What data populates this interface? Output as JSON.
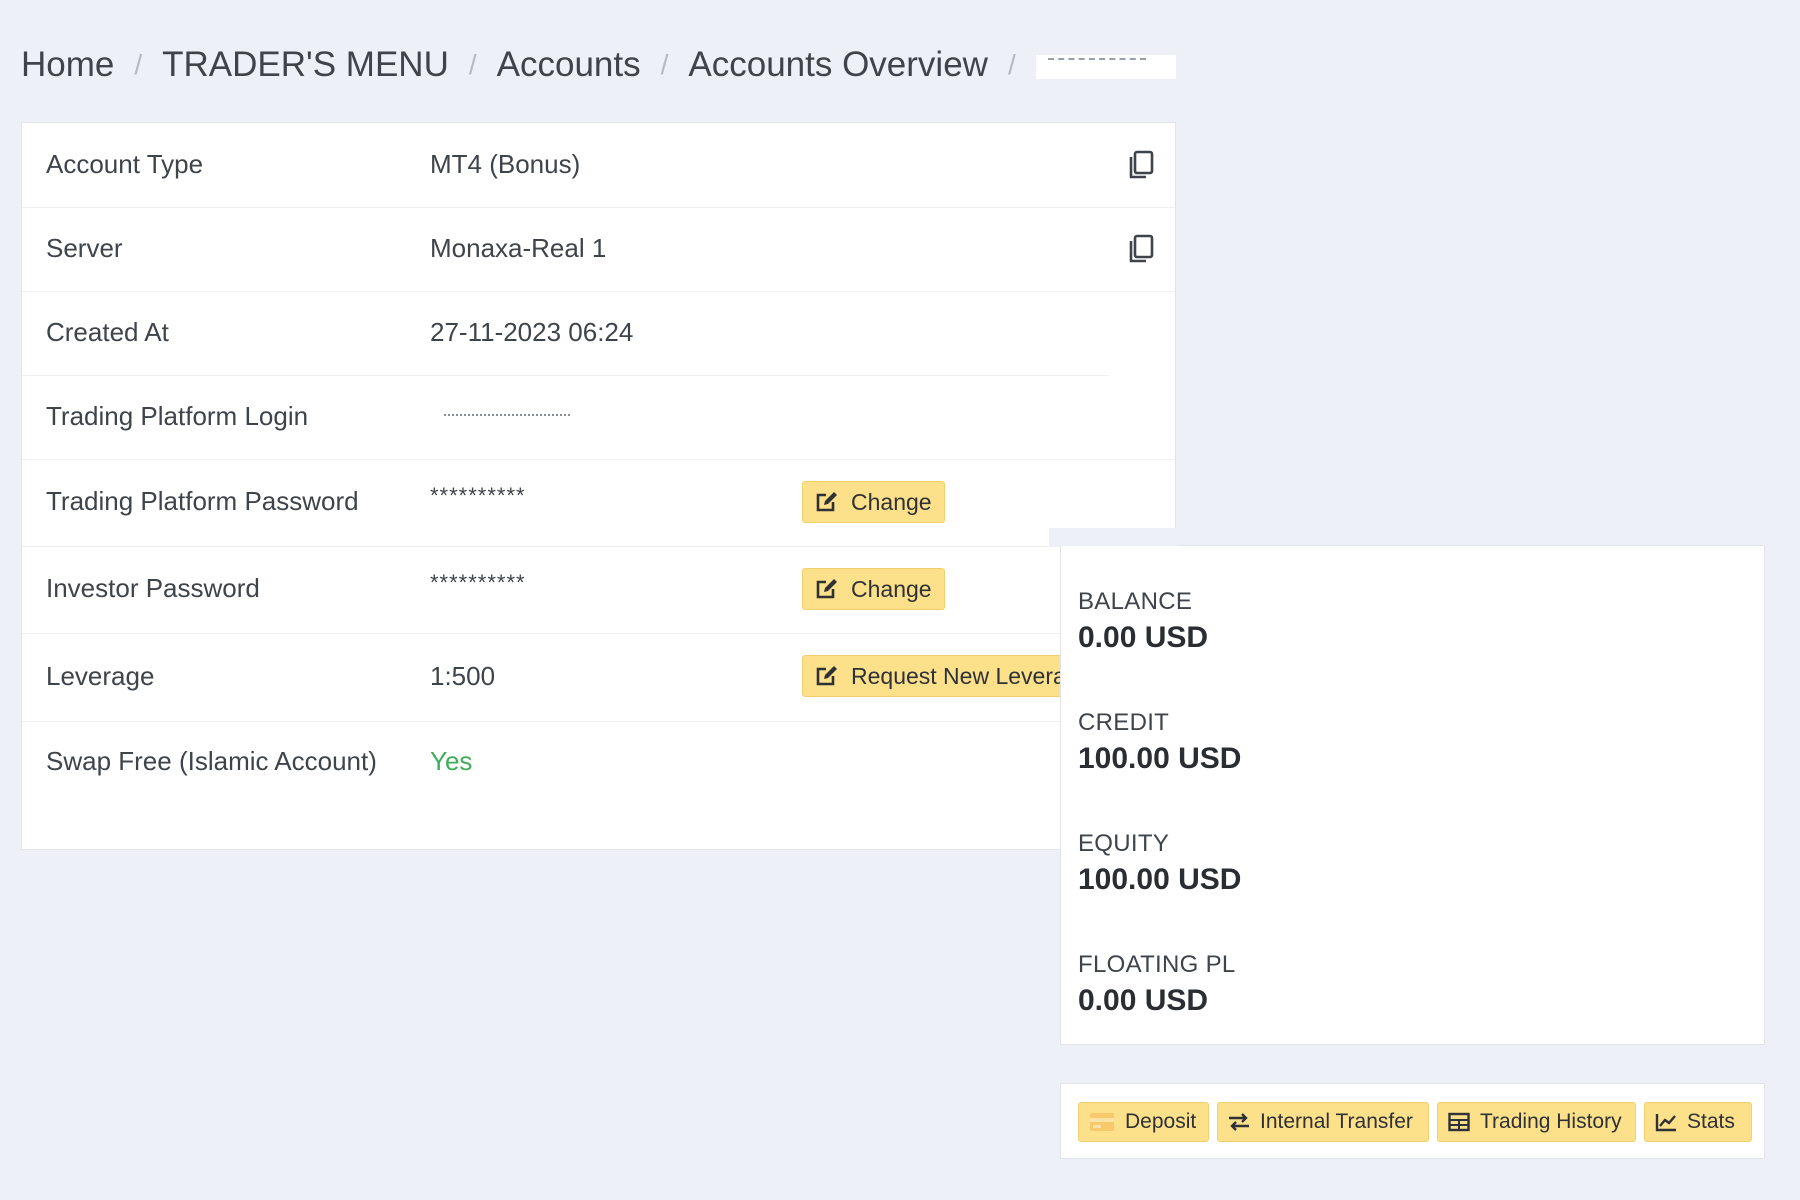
{
  "breadcrumb": {
    "items": [
      "Home",
      "TRADER'S MENU",
      "Accounts",
      "Accounts Overview"
    ],
    "separator": "/"
  },
  "details": {
    "account_type": {
      "label": "Account Type",
      "value": "MT4 (Bonus)"
    },
    "server": {
      "label": "Server",
      "value": "Monaxa-Real 1"
    },
    "created_at": {
      "label": "Created At",
      "value": "27-11-2023 06:24"
    },
    "login": {
      "label": "Trading Platform Login"
    },
    "password": {
      "label": "Trading Platform Password",
      "value": "**********",
      "button": "Change"
    },
    "investor_password": {
      "label": "Investor Password",
      "value": "**********",
      "button": "Change"
    },
    "leverage": {
      "label": "Leverage",
      "value": "1:500",
      "button": "Request New Levera"
    },
    "swap_free": {
      "label": "Swap Free (Islamic Account)",
      "value": "Yes"
    }
  },
  "balances": {
    "balance": {
      "label": "BALANCE",
      "value": "0.00 USD"
    },
    "credit": {
      "label": "CREDIT",
      "value": "100.00 USD"
    },
    "equity": {
      "label": "EQUITY",
      "value": "100.00 USD"
    },
    "floating_pl": {
      "label": "FLOATING PL",
      "value": "0.00 USD"
    }
  },
  "actions": {
    "deposit": "Deposit",
    "internal_transfer": "Internal Transfer",
    "trading_history": "Trading History",
    "stats": "Stats"
  },
  "colors": {
    "background": "#edf0f7",
    "button_yellow": "#fce08a",
    "success_green": "#3fae5a",
    "text": "#3f444b"
  },
  "icons": {
    "copy": "copy-icon",
    "edit": "edit-icon",
    "deposit": "credit-card-icon",
    "transfer": "exchange-icon",
    "history": "table-icon",
    "stats": "line-chart-icon"
  }
}
